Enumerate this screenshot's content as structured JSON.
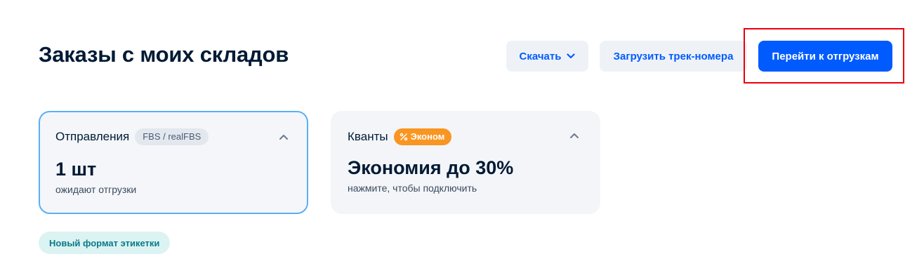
{
  "header": {
    "title": "Заказы с моих складов"
  },
  "toolbar": {
    "download_label": "Скачать",
    "upload_tracking_label": "Загрузить трек-номера",
    "go_to_shipments_label": "Перейти к отгрузкам"
  },
  "cards": {
    "shipments": {
      "title": "Отправления",
      "tag": "FBS / realFBS",
      "value": "1 шт",
      "subtitle": "ожидают отгрузки"
    },
    "kvanty": {
      "title": "Кванты",
      "tag": "Эконом",
      "value": "Экономия до 30%",
      "subtitle": "нажмите, чтобы подключить"
    }
  },
  "label_format": {
    "text": "Новый формат этикетки"
  },
  "colors": {
    "accent": "#005bff",
    "highlight": "#e8000b",
    "econom_tag": "#f99521",
    "label_pill_bg": "#dcf3f3"
  },
  "icons": {
    "download_chevron": "chevron-down-icon",
    "collapse": "chevron-up-icon",
    "discount": "percent-icon"
  }
}
